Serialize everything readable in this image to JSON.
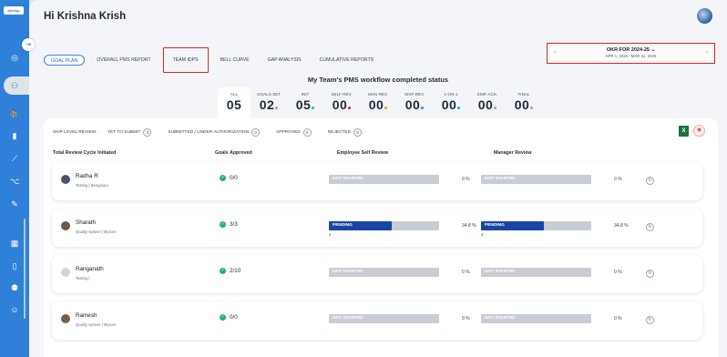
{
  "sidebar": {
    "logo": "alertop",
    "icons": [
      "collapse-icon",
      "target-icon",
      "team-icon",
      "walk-icon",
      "book-icon",
      "chart-icon",
      "flow-icon",
      "edit-icon",
      "calendar-icon",
      "book2-icon",
      "people-icon",
      "person-icon"
    ]
  },
  "header": {
    "greeting": "Hi Krishna Krish"
  },
  "tabs": [
    {
      "label": "GOAL PLAN"
    },
    {
      "label": "OVERALL PMS REPORT"
    },
    {
      "label": "TEAM IDPS"
    },
    {
      "label": "BELL CURVE"
    },
    {
      "label": "GAP ANALYSIS"
    },
    {
      "label": "CUMULATIVE REPORTS"
    }
  ],
  "okr": {
    "title": "OKR FOR 2024-25 ⌄",
    "range": "APR 1, 2024 - MAR 31, 2025",
    "prev": "‹",
    "next": "›"
  },
  "status_title": "My Team's PMS workflow completed status",
  "stats": [
    {
      "label": "ALL",
      "value": "05",
      "dot": ""
    },
    {
      "label": "GOALS SET",
      "value": "02",
      "dot": "#9ca3af"
    },
    {
      "label": "INIT",
      "value": "05",
      "dot": "#22c55e"
    },
    {
      "label": "SELF REV.",
      "value": "00",
      "dot": "#e11d48"
    },
    {
      "label": "MAN REV.",
      "value": "00",
      "dot": "#f59e0b"
    },
    {
      "label": "SKIP REV.",
      "value": "00",
      "dot": "#3b82f6"
    },
    {
      "label": "1-ON-1",
      "value": "00",
      "dot": "#06b6d4"
    },
    {
      "label": "EMP. ACK.",
      "value": "00",
      "dot": "#9ca3af"
    },
    {
      "label": "FINAL",
      "value": "00",
      "dot": "#9ca3af"
    }
  ],
  "filter": {
    "label": "SKIP LEVEL REVIEW :",
    "groups": [
      {
        "label": "YET TO SUBMIT",
        "count": "0"
      },
      {
        "label": "SUBMITTED / UNDER AUTHORIZATION",
        "count": "0"
      },
      {
        "label": "APPROVED",
        "count": "0"
      },
      {
        "label": "REJECTED",
        "count": "0"
      }
    ]
  },
  "columns": {
    "name": "Total Review Cycle Initiated",
    "goals": "Goals Approved",
    "self": "Employee Self Review",
    "manager": "Manager Review"
  },
  "rows": [
    {
      "name": "Radha R",
      "sub": "Testing | Bengaluru",
      "goals": "0/0",
      "self_status": "NOT STARTED",
      "self_pct": "0 %",
      "self_fill": 0,
      "self_two": "",
      "mgr_status": "NOT STARTED",
      "mgr_pct": "0 %",
      "mgr_fill": 0,
      "mgr_two": "",
      "avatar_color": "#4b5563"
    },
    {
      "name": "Sharath",
      "sub": "Quality system | Mysore",
      "goals": "3/3",
      "self_status": "PENDING",
      "self_pct": "34.8 %",
      "self_fill": 0.348,
      "self_two": "2",
      "mgr_status": "PENDING",
      "mgr_pct": "34.8 %",
      "mgr_fill": 0.348,
      "mgr_two": "2",
      "avatar_color": "#6b5b4b"
    },
    {
      "name": "Ranganath",
      "sub": "Testing |",
      "goals": "2/10",
      "self_status": "NOT STARTED",
      "self_pct": "0 %",
      "self_fill": 0,
      "self_two": "",
      "mgr_status": "NOT STARTED",
      "mgr_pct": "0 %",
      "mgr_fill": 0,
      "mgr_two": "",
      "avatar_color": "#d1d5db"
    },
    {
      "name": "Ramesh",
      "sub": "Quality system | Mysore",
      "goals": "0/0",
      "self_status": "NOT STARTED",
      "self_pct": "0 %",
      "self_fill": 0,
      "self_two": "",
      "mgr_status": "NOT STARTED",
      "mgr_pct": "0 %",
      "mgr_fill": 0,
      "mgr_two": "",
      "avatar_color": "#7c5e48"
    }
  ],
  "colors": {
    "sidebar": "#2f80d8",
    "pending": "#1746a2",
    "not_started": "#c8ccd3",
    "highlight": "#d62828"
  }
}
